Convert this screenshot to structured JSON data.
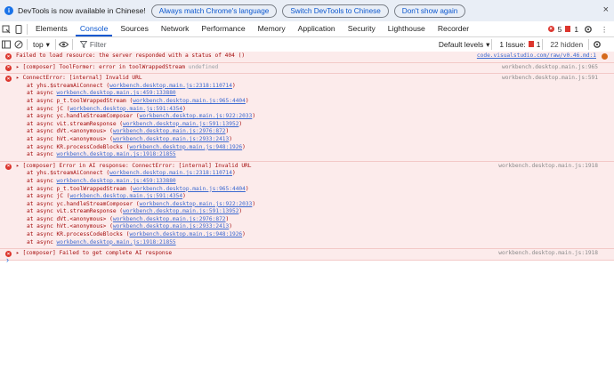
{
  "infobar": {
    "message": "DevTools is now available in Chinese!",
    "btn_match": "Always match Chrome's language",
    "btn_switch": "Switch DevTools to Chinese",
    "btn_dont": "Don't show again",
    "close": "×"
  },
  "tabs": [
    "Elements",
    "Console",
    "Sources",
    "Network",
    "Performance",
    "Memory",
    "Application",
    "Security",
    "Lighthouse",
    "Recorder"
  ],
  "active_tab": "Console",
  "badges": {
    "errors": "5",
    "issues": "1"
  },
  "filterbar": {
    "context": "top",
    "filter_placeholder": "Filter",
    "levels": "Default levels",
    "issues_label": "1 Issue:",
    "issues_count": "1",
    "hidden": "22 hidden"
  },
  "messages": {
    "m1": {
      "text": "Failed to load resource: the server responded with a status of 404 ()",
      "source": "code.visualstudio.com/raw/v0.46.md:1"
    },
    "m2": {
      "prefix": "[composer] ToolFormer: error in toolWrappedStream",
      "suffix": "undefined",
      "source": "workbench.desktop.main.js:965"
    },
    "m3": {
      "head": "ConnectError: [internal] Invalid URL",
      "source": "workbench.desktop.main.js:591",
      "stack": [
        {
          "pre": "at yhs.$streamAiConnect (",
          "link": "workbench.desktop.main.js:2318:110714",
          "post": ")"
        },
        {
          "pre": "at async ",
          "link": "workbench.desktop.main.js:459:133880",
          "post": ""
        },
        {
          "pre": "at async p_t.toolWrappedStream (",
          "link": "workbench.desktop.main.js:965:4404",
          "post": ")"
        },
        {
          "pre": "at async jC (",
          "link": "workbench.desktop.main.js:591:4354",
          "post": ")"
        },
        {
          "pre": "at async yc.handleStreamComposer (",
          "link": "workbench.desktop.main.js:922:2033",
          "post": ")"
        },
        {
          "pre": "at async vLt.streamResponse (",
          "link": "workbench.desktop.main.js:591:13952",
          "post": ")"
        },
        {
          "pre": "at async dVt.<anonymous> (",
          "link": "workbench.desktop.main.js:2976:872",
          "post": ")"
        },
        {
          "pre": "at async hVt.<anonymous> (",
          "link": "workbench.desktop.main.js:2933:2413",
          "post": ")"
        },
        {
          "pre": "at async KR.processCodeBlocks (",
          "link": "workbench.desktop.main.js:948:1926",
          "post": ")"
        },
        {
          "pre": "at async ",
          "link": "workbench.desktop.main.js:1918:21855",
          "post": ""
        }
      ]
    },
    "m4": {
      "head": "[composer] Error in AI response: ConnectError: [internal] Invalid URL",
      "source": "workbench.desktop.main.js:1918",
      "stack": [
        {
          "pre": "at yhs.$streamAiConnect (",
          "link": "workbench.desktop.main.js:2318:110714",
          "post": ")"
        },
        {
          "pre": "at async ",
          "link": "workbench.desktop.main.js:459:133880",
          "post": ""
        },
        {
          "pre": "at async p_t.toolWrappedStream (",
          "link": "workbench.desktop.main.js:965:4404",
          "post": ")"
        },
        {
          "pre": "at async jC (",
          "link": "workbench.desktop.main.js:591:4354",
          "post": ")"
        },
        {
          "pre": "at async yc.handleStreamComposer (",
          "link": "workbench.desktop.main.js:922:2033",
          "post": ")"
        },
        {
          "pre": "at async vLt.streamResponse (",
          "link": "workbench.desktop.main.js:591:13952",
          "post": ")"
        },
        {
          "pre": "at async dVt.<anonymous> (",
          "link": "workbench.desktop.main.js:2976:872",
          "post": ")"
        },
        {
          "pre": "at async hVt.<anonymous> (",
          "link": "workbench.desktop.main.js:2933:2413",
          "post": ")"
        },
        {
          "pre": "at async KR.processCodeBlocks (",
          "link": "workbench.desktop.main.js:948:1926",
          "post": ")"
        },
        {
          "pre": "at async ",
          "link": "workbench.desktop.main.js:1918:21855",
          "post": ""
        }
      ]
    },
    "m5": {
      "text": "[composer] Failed to get complete AI response",
      "source": "workbench.desktop.main.js:1918"
    }
  },
  "colors": {
    "accent": "#0b57d0",
    "error": "#dc362e",
    "error_bg": "#fcebeb"
  }
}
